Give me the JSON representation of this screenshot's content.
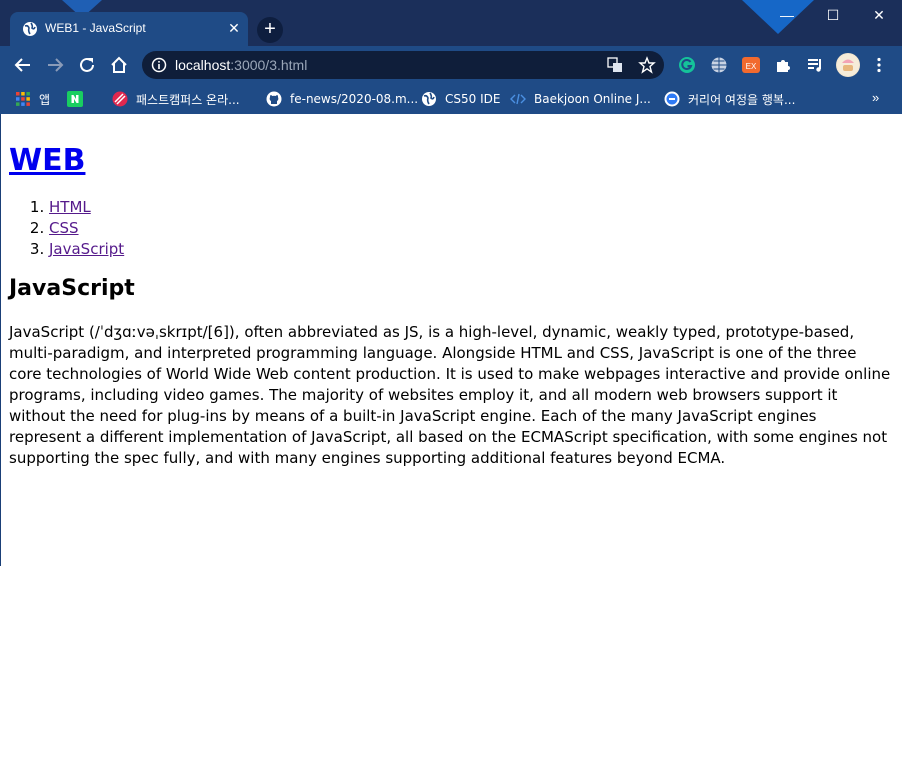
{
  "browser": {
    "tab": {
      "title": "WEB1 - JavaScript",
      "close": "✕"
    },
    "new_tab": "+",
    "window_controls": {
      "minimize": "—",
      "maximize": "☐",
      "close": "✕"
    },
    "url": {
      "host": "localhost",
      "path": ":3000/3.html"
    },
    "bookmarks": [
      {
        "label": "앱",
        "icon": "apps-grid-icon",
        "color": "#ea4335"
      },
      {
        "label": "",
        "icon": "naver-icon",
        "color": "#19ce60"
      },
      {
        "label": "패스트캠퍼스 온라...",
        "icon": "fastcampus-icon",
        "color": "#e0284f"
      },
      {
        "label": "fe-news/2020-08.m...",
        "icon": "github-icon",
        "color": "#ffffff"
      },
      {
        "label": "CS50 IDE",
        "icon": "globe-icon",
        "color": "#ffffff"
      },
      {
        "label": "Baekjoon Online J...",
        "icon": "code-icon",
        "color": "#4b90e2"
      },
      {
        "label": "커리어 여정을 행복...",
        "icon": "career-icon",
        "color": "#2f7bf6"
      }
    ],
    "bookmarks_more": "»",
    "colors": {
      "frame": "#1b2f5a",
      "toolbar": "#1f4b86",
      "omnibox": "#0f1e3a"
    }
  },
  "page": {
    "heading": "WEB",
    "nav": [
      "HTML",
      "CSS",
      "JavaScript"
    ],
    "section_title": "JavaScript",
    "article": "JavaScript (/ˈdʒɑːvəˌskrɪpt/[6]), often abbreviated as JS, is a high-level, dynamic, weakly typed, prototype-based, multi-paradigm, and interpreted programming language. Alongside HTML and CSS, JavaScript is one of the three core technologies of World Wide Web content production. It is used to make webpages interactive and provide online programs, including video games. The majority of websites employ it, and all modern web browsers support it without the need for plug-ins by means of a built-in JavaScript engine. Each of the many JavaScript engines represent a different implementation of JavaScript, all based on the ECMAScript specification, with some engines not supporting the spec fully, and with many engines supporting additional features beyond ECMA."
  }
}
